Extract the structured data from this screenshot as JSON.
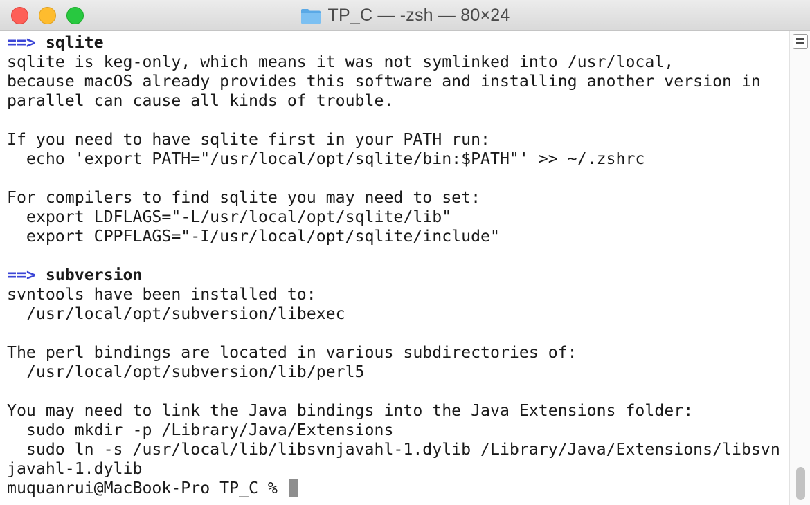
{
  "window": {
    "title": "TP_C — -zsh — 80×24"
  },
  "terminal": {
    "lines": [
      {
        "arrow": "==>",
        "text": " ",
        "bold": "sqlite"
      },
      {
        "text": "sqlite is keg-only, which means it was not symlinked into /usr/local,"
      },
      {
        "text": "because macOS already provides this software and installing another version in"
      },
      {
        "text": "parallel can cause all kinds of trouble."
      },
      {
        "text": ""
      },
      {
        "text": "If you need to have sqlite first in your PATH run:"
      },
      {
        "text": "  echo 'export PATH=\"/usr/local/opt/sqlite/bin:$PATH\"' >> ~/.zshrc"
      },
      {
        "text": ""
      },
      {
        "text": "For compilers to find sqlite you may need to set:"
      },
      {
        "text": "  export LDFLAGS=\"-L/usr/local/opt/sqlite/lib\""
      },
      {
        "text": "  export CPPFLAGS=\"-I/usr/local/opt/sqlite/include\""
      },
      {
        "text": ""
      },
      {
        "arrow": "==>",
        "text": " ",
        "bold": "subversion"
      },
      {
        "text": "svntools have been installed to:"
      },
      {
        "text": "  /usr/local/opt/subversion/libexec"
      },
      {
        "text": ""
      },
      {
        "text": "The perl bindings are located in various subdirectories of:"
      },
      {
        "text": "  /usr/local/opt/subversion/lib/perl5"
      },
      {
        "text": ""
      },
      {
        "text": "You may need to link the Java bindings into the Java Extensions folder:"
      },
      {
        "text": "  sudo mkdir -p /Library/Java/Extensions"
      },
      {
        "text": "  sudo ln -s /usr/local/lib/libsvnjavahl-1.dylib /Library/Java/Extensions/libsvn"
      },
      {
        "text": "javahl-1.dylib"
      }
    ],
    "prompt": "muquanrui@MacBook-Pro TP_C % "
  },
  "colors": {
    "arrow": "#3b45d6",
    "cursor": "#8e8e8e",
    "close": "#fe5f57",
    "minimize": "#febc2e",
    "zoom": "#28c840",
    "folder": "#5aa9e6"
  },
  "icons": {
    "title": "folder-icon",
    "split": "split-pane-icon"
  }
}
